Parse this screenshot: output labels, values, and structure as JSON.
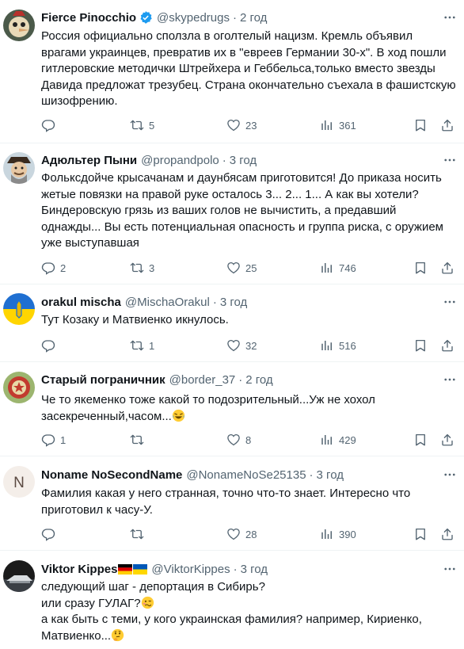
{
  "colors": {
    "verified": "#1d9bf0",
    "text": "#0f1419",
    "secondary": "#536471",
    "divider": "#eff3f4"
  },
  "posts": [
    {
      "name": "Fierce Pinocchio",
      "handle": "@skypedrugs",
      "dot": "·",
      "time": "2 год",
      "verified": true,
      "lines": [
        "Россия официально сползла в оголтелый нацизм. Кремль объявил",
        "врагами украинцев, превратив их в \"евреев Германии 30-х\". В ход пошли",
        "гитлеровские методички Штрейхера и Геббельса,только вместо звезды",
        "Давида предложат трезубец. Страна окончательно съехала в фашистскую",
        "шизофрению."
      ],
      "replies": "",
      "retweets": "5",
      "likes": "23",
      "views": "361"
    },
    {
      "name": "Адюльтер Пыни",
      "handle": "@propandpolo",
      "dot": "·",
      "time": "3 год",
      "lines": [
        "Фольксдойче крысачанам и даунбясам приготовится! До приказа носить",
        "жетые повязки на правой руке осталось 3... 2... 1... А как вы хотели?",
        "Биндеровскую грязь из ваших голов не вычистить, а предавший",
        "однажды... Вы есть потенциальная опасность и группа риска, с оружием",
        "уже выступавшая"
      ],
      "replies": "2",
      "retweets": "3",
      "likes": "25",
      "views": "746"
    },
    {
      "name": "orakul mischa",
      "handle": "@MischaOrakul",
      "dot": "·",
      "time": "3 год",
      "lines": [
        "Тут Козаку и Матвиенко икнулось."
      ],
      "replies": "",
      "retweets": "1",
      "likes": "32",
      "views": "516"
    },
    {
      "name": "Старый пограничник",
      "handle": "@border_37",
      "dot": "·",
      "time": "2 год",
      "lines": [
        "Че то якеменко тоже какой то подозрительный...Уж не хохол",
        "засекреченный,часом..."
      ],
      "replies": "1",
      "retweets": "",
      "likes": "8",
      "views": "429"
    },
    {
      "name": "Noname NoSecondName",
      "handle": "@NonameNoSe25135",
      "dot": "·",
      "time": "3 год",
      "avatar_letter": "N",
      "lines": [
        "Фамилия какая у него странная, точно что-то знает. Интересно что",
        "приготовил к часу-У."
      ],
      "replies": "",
      "retweets": "",
      "likes": "28",
      "views": "390"
    },
    {
      "name": "Viktor Kippes",
      "handle": "@ViktorKippes",
      "dot": "·",
      "time": "3 год",
      "lines": [
        "следующий шаг - депортация в Сибирь?",
        "или сразу ГУЛАГ?",
        "а как быть с теми, у кого украинская фамилия? например, Кириенко,",
        "Матвиенко..."
      ]
    }
  ]
}
